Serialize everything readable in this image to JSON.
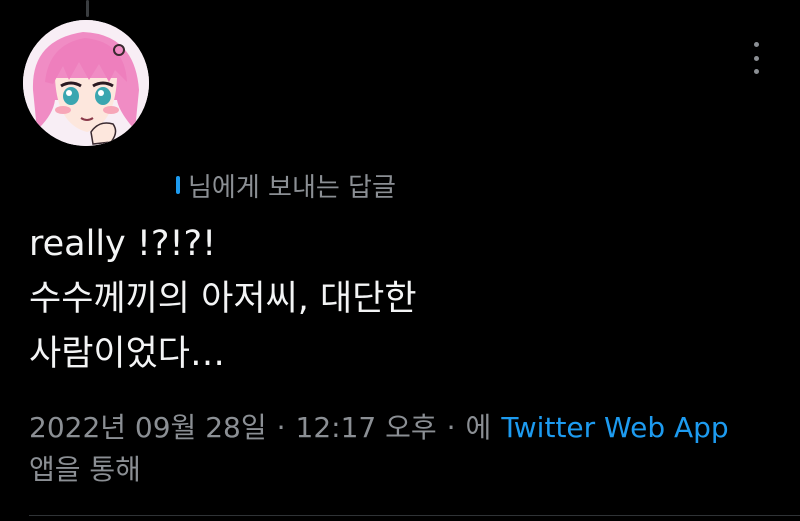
{
  "reply_header": {
    "mention": "",
    "suffix": "님에게 보내는 답글"
  },
  "tweet": {
    "lines": [
      "really !?!?!",
      "수수께끼의 아저씨, 대단한",
      "사람이었다…"
    ]
  },
  "meta": {
    "date": "2022년 09월 28일",
    "time": "12:17 오후",
    "separator": "·",
    "via_prefix": "에",
    "source": "Twitter Web App",
    "via_suffix": "앱을 통해"
  },
  "colors": {
    "background": "#000000",
    "text": "#f3f4f5",
    "secondary": "#8b8f94",
    "link": "#1d9bf0"
  },
  "icons": {
    "more": "more-vertical-icon",
    "avatar": "anime-character-avatar"
  }
}
